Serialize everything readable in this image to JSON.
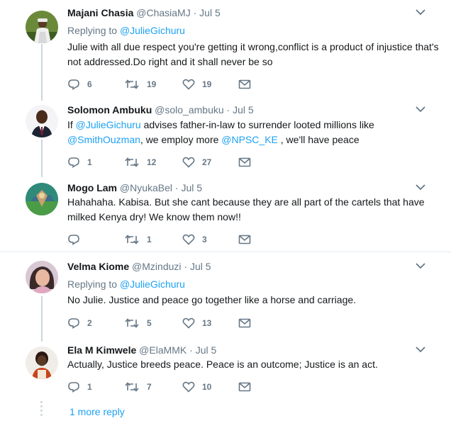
{
  "colors": {
    "link": "#1da1f2",
    "muted": "#657786",
    "text": "#14171a",
    "thread_line": "#ccd6dd"
  },
  "tweets": [
    {
      "name": "Majani Chasia",
      "handle": "@ChasiaMJ",
      "separator": "·",
      "date": "Jul 5",
      "replying_prefix": "Replying to",
      "replying_to": "@JulieGichuru",
      "text": "Julie with all due respect you're getting it wrong,conflict is a product of injustice that's not addressed.Do right and it shall never be so",
      "replies": "6",
      "retweets": "19",
      "likes": "19"
    },
    {
      "name": "Solomon Ambuku",
      "handle": "@solo_ambuku",
      "separator": "·",
      "date": "Jul 5",
      "text_parts": [
        "If ",
        "@JulieGichuru",
        " advises father-in-law to surrender looted millions like ",
        "@SmithOuzman",
        ", we employ more ",
        "@NPSC_KE",
        " , we'll have  peace"
      ],
      "replies": "1",
      "retweets": "12",
      "likes": "27"
    },
    {
      "name": "Mogo Lam",
      "handle": "@NyukaBel",
      "separator": "·",
      "date": "Jul 5",
      "text": "Hahahaha. Kabisa. But she cant because they are all part of the cartels that have milked Kenya dry! We know them now!!",
      "replies": "",
      "retweets": "1",
      "likes": "3"
    },
    {
      "name": "Velma Kiome",
      "handle": "@Mzinduzi",
      "separator": "·",
      "date": "Jul 5",
      "replying_prefix": "Replying to",
      "replying_to": "@JulieGichuru",
      "text": "No Julie. Justice and peace go together like a horse and carriage.",
      "replies": "2",
      "retweets": "5",
      "likes": "13"
    },
    {
      "name": "Ela M Kimwele",
      "handle": "@ElaMMK",
      "separator": "·",
      "date": "Jul 5",
      "text": "Actually, Justice breeds peace. Peace is an outcome; Justice is an act.",
      "replies": "1",
      "retweets": "7",
      "likes": "10"
    }
  ],
  "more_replies": "1 more reply",
  "icons": {
    "reply": "reply-icon",
    "retweet": "retweet-icon",
    "like": "heart-icon",
    "dm": "envelope-icon",
    "caret": "chevron-down-icon"
  }
}
